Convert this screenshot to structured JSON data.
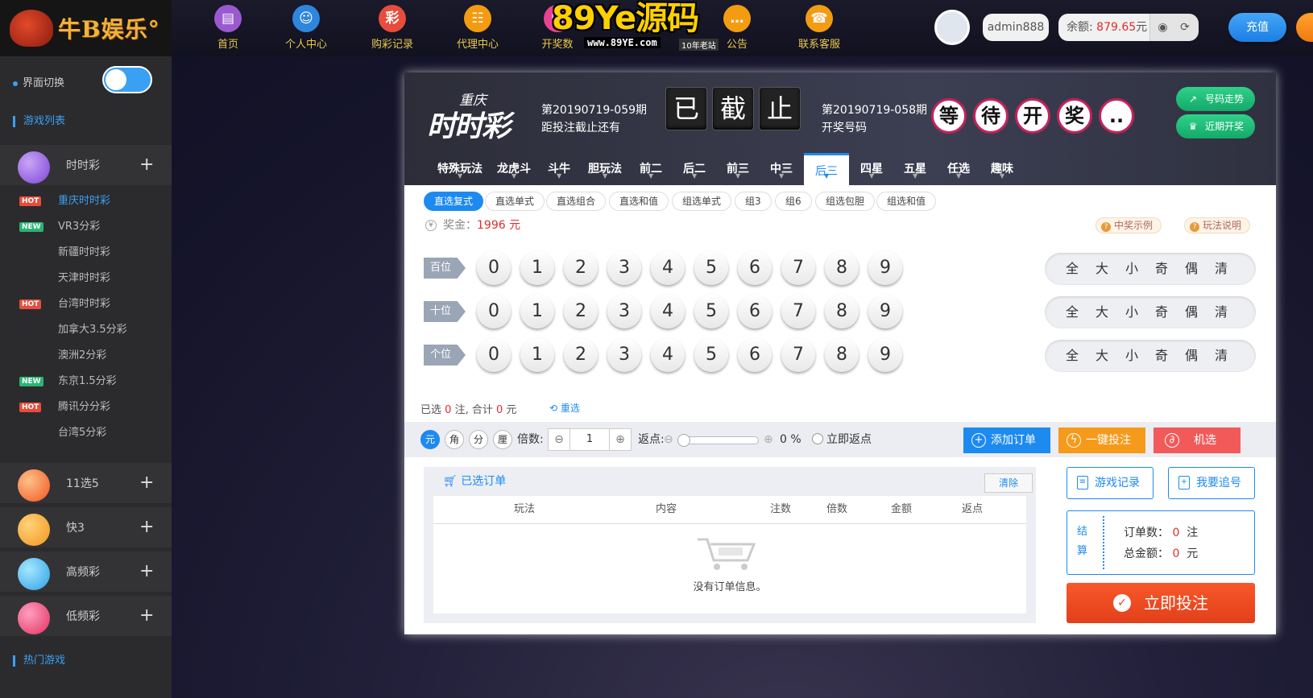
{
  "logo": {
    "text": "牛B娱乐°"
  },
  "nav": [
    {
      "label": "首页",
      "icon": "home-icon",
      "color": "#9b59d0"
    },
    {
      "label": "个人中心",
      "icon": "user-icon",
      "color": "#2e86de"
    },
    {
      "label": "购彩记录",
      "icon": "lottery-record-icon",
      "color": "#e74c3c"
    },
    {
      "label": "代理中心",
      "icon": "agent-icon",
      "color": "#f39c12"
    },
    {
      "label": "开奖数",
      "icon": "draw-icon",
      "color": "#e84393"
    },
    {
      "label": "公告",
      "icon": "notice-icon",
      "color": "#f39c12"
    },
    {
      "label": "联系客服",
      "icon": "support-icon",
      "color": "#f39c12"
    }
  ],
  "watermark": {
    "big": "89Ye源码",
    "small": "www.89YE.com",
    "tag": "10年老站"
  },
  "user": {
    "name": "admin888",
    "balance_label": "余额:",
    "balance": "879.65",
    "unit": "元",
    "recharge": "充值"
  },
  "sidebar": {
    "switch_label": "界面切换",
    "game_list_title": "游戏列表",
    "hot_games_title": "热门游戏",
    "categories": [
      {
        "label": "时时彩",
        "icon": "ssc-icon"
      },
      {
        "label": "11选5",
        "icon": "11x5-icon"
      },
      {
        "label": "快3",
        "icon": "k3-icon"
      },
      {
        "label": "高频彩",
        "icon": "high-freq-icon"
      },
      {
        "label": "低频彩",
        "icon": "low-freq-icon"
      }
    ],
    "games": [
      {
        "name": "重庆时时彩",
        "badge": "HOT"
      },
      {
        "name": "VR3分彩",
        "badge": "NEW"
      },
      {
        "name": "新疆时时彩",
        "badge": ""
      },
      {
        "name": "天津时时彩",
        "badge": ""
      },
      {
        "name": "台湾时时彩",
        "badge": "HOT"
      },
      {
        "name": "加拿大3.5分彩",
        "badge": ""
      },
      {
        "name": "澳洲2分彩",
        "badge": ""
      },
      {
        "name": "东京1.5分彩",
        "badge": "NEW"
      },
      {
        "name": "腾讯分分彩",
        "badge": "HOT"
      },
      {
        "name": "台湾5分彩",
        "badge": ""
      }
    ]
  },
  "game": {
    "brand_top": "重庆",
    "brand_main": "时时彩",
    "current_issue": "第20190719-059期",
    "countdown_label": "距投注截止还有",
    "countdown": [
      "已",
      "截",
      "止"
    ],
    "last_issue": "第20190719-058期",
    "last_label": "开奖号码",
    "result": [
      "等",
      "待",
      "开",
      "奖",
      ".."
    ],
    "trend_btn": "号码走势",
    "recent_btn": "近期开奖"
  },
  "tabs": [
    "特殊玩法",
    "龙虎斗",
    "斗牛",
    "胆玩法",
    "前二",
    "后二",
    "前三",
    "中三",
    "后三",
    "四星",
    "五星",
    "任选",
    "趣味"
  ],
  "subtabs": [
    "直选复式",
    "直选单式",
    "直选组合",
    "直选和值",
    "组选单式",
    "组3",
    "组6",
    "组选包胆",
    "组选和值"
  ],
  "prize": {
    "label": "奖金：",
    "value": "1996",
    "unit": "元"
  },
  "help": {
    "example": "中奖示例",
    "rules": "玩法说明"
  },
  "rows": [
    {
      "label": "百位"
    },
    {
      "label": "十位"
    },
    {
      "label": "个位"
    }
  ],
  "digits": [
    "0",
    "1",
    "2",
    "3",
    "4",
    "5",
    "6",
    "7",
    "8",
    "9"
  ],
  "quick": [
    "全",
    "大",
    "小",
    "奇",
    "偶",
    "清"
  ],
  "summary": {
    "p1": "已选",
    "bets": "0",
    "p2": "注, 合计",
    "amount": "0",
    "p3": "元",
    "reset": "重选"
  },
  "toolbar": {
    "units": [
      "元",
      "角",
      "分",
      "厘"
    ],
    "multiple_label": "倍数:",
    "multiple": "1",
    "rebate_label": "返点:",
    "rebate": "0 %",
    "instant_rebate": "立即返点",
    "add_order": "添加订单",
    "one_click": "一键投注",
    "random": "机选"
  },
  "orders": {
    "title": "已选订单",
    "clear": "清除",
    "columns": [
      "玩法",
      "内容",
      "注数",
      "倍数",
      "金额",
      "返点"
    ],
    "empty": "没有订单信息。"
  },
  "side": {
    "history": "游戏记录",
    "chase": "我要追号",
    "settle": "结算",
    "order_count_label": "订单数：",
    "order_count": "0",
    "order_unit": "注",
    "total_label": "总金额：",
    "total": "0",
    "total_unit": "元",
    "submit": "立即投注"
  }
}
